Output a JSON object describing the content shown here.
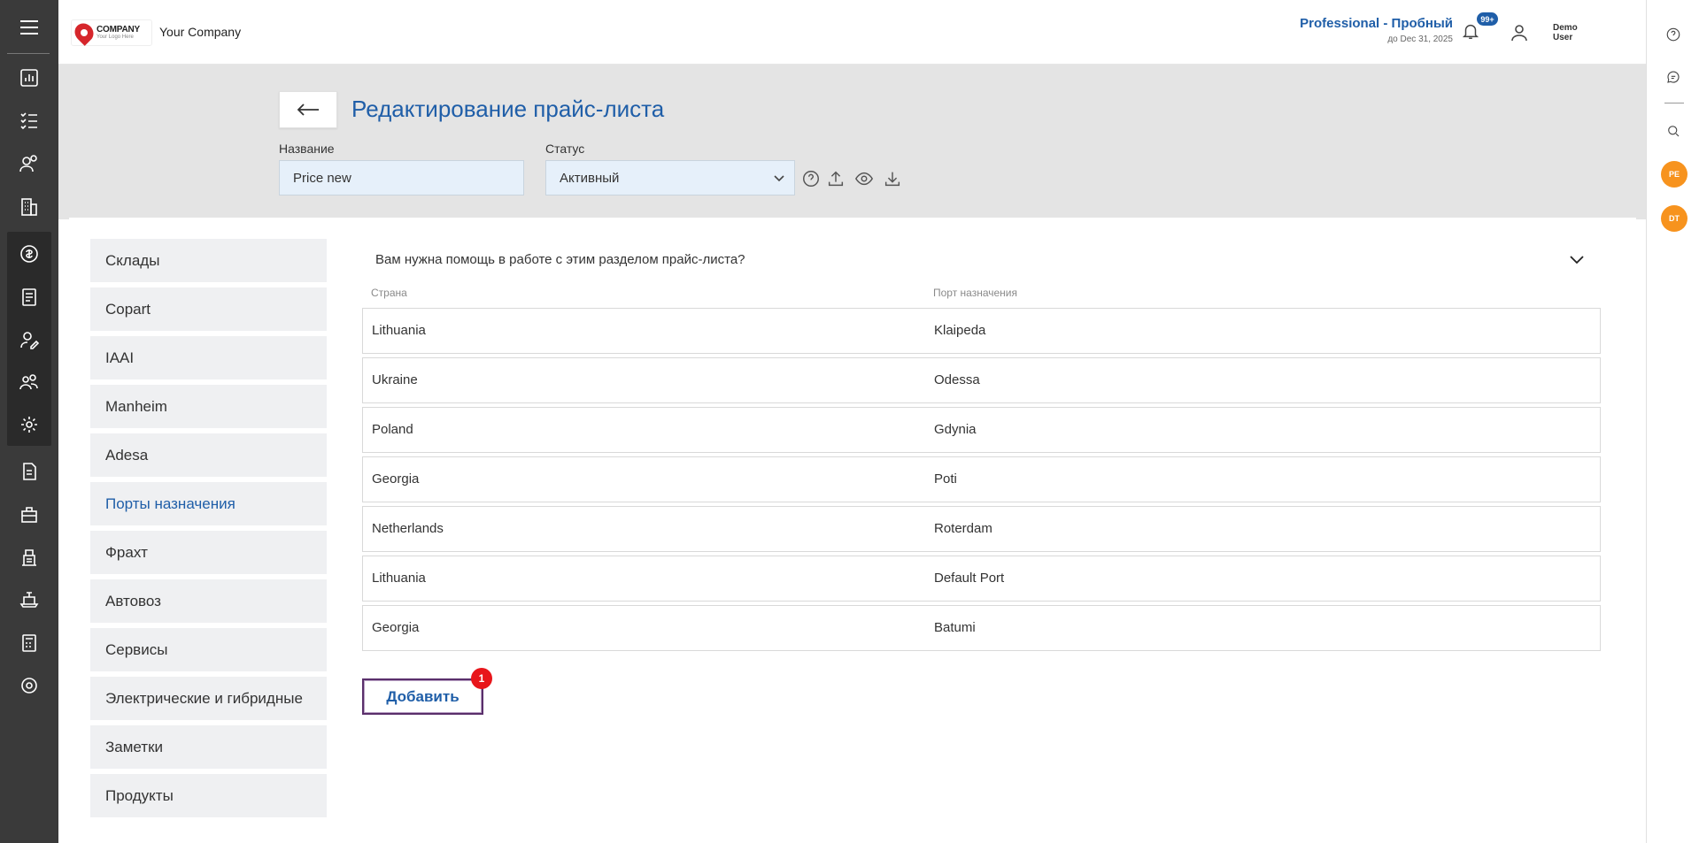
{
  "header": {
    "logo_text": "COMPANY",
    "logo_sub": "Your Logo Here",
    "company_name": "Your Company",
    "plan_name": "Professional - Пробный",
    "plan_expiry": "до Dec 31, 2025",
    "notifications_count": "99+",
    "user_name": "Demo User"
  },
  "page": {
    "title": "Редактирование прайс-листа",
    "name_label": "Название",
    "name_value": "Price new",
    "status_label": "Статус",
    "status_value": "Активный"
  },
  "sections": [
    {
      "label": "Склады"
    },
    {
      "label": "Copart"
    },
    {
      "label": "IAAI"
    },
    {
      "label": "Manheim"
    },
    {
      "label": "Adesa"
    },
    {
      "label": "Порты назначения"
    },
    {
      "label": "Фрахт"
    },
    {
      "label": "Автовоз"
    },
    {
      "label": "Сервисы"
    },
    {
      "label": "Электрические и гибридные"
    },
    {
      "label": "Заметки"
    },
    {
      "label": "Продукты"
    }
  ],
  "active_section": "Порты назначения",
  "help_text": "Вам нужна помощь в работе с этим разделом прайс-листа?",
  "table": {
    "columns": [
      "Страна",
      "Порт назначения"
    ],
    "rows": [
      {
        "country": "Lithuania",
        "port": "Klaipeda"
      },
      {
        "country": "Ukraine",
        "port": "Odessa"
      },
      {
        "country": "Poland",
        "port": "Gdynia"
      },
      {
        "country": "Georgia",
        "port": "Poti"
      },
      {
        "country": "Netherlands",
        "port": "Roterdam"
      },
      {
        "country": "Lithuania",
        "port": "Default Port"
      },
      {
        "country": "Georgia",
        "port": "Batumi"
      }
    ]
  },
  "add_button_label": "Добавить",
  "add_button_badge": "1",
  "right_rail": {
    "avatar_1": "PE",
    "avatar_2": "DT"
  },
  "colors": {
    "accent": "#1f5ea8",
    "sidebar_bg": "#3a3a3a",
    "avatar_bg": "#f7931e",
    "badge_red": "#e8161b"
  }
}
